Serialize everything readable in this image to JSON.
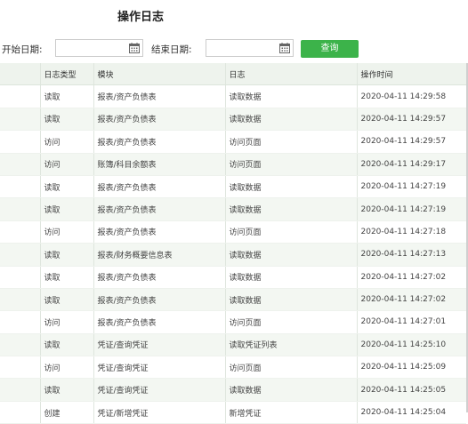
{
  "page": {
    "title": "操作日志"
  },
  "filters": {
    "start_label": "开始日期:",
    "end_label": "结束日期:",
    "start_value": "",
    "end_value": "",
    "query_label": "查询",
    "calendar_icon": "calendar-icon"
  },
  "table": {
    "headers": [
      "日志类型",
      "模块",
      "日志",
      "操作时间"
    ],
    "rows": [
      [
        "读取",
        "报表/资产负债表",
        "读取数据",
        "2020-04-11 14:29:58"
      ],
      [
        "读取",
        "报表/资产负债表",
        "读取数据",
        "2020-04-11 14:29:57"
      ],
      [
        "访问",
        "报表/资产负债表",
        "访问页面",
        "2020-04-11 14:29:57"
      ],
      [
        "访问",
        "账簿/科目余额表",
        "访问页面",
        "2020-04-11 14:29:17"
      ],
      [
        "读取",
        "报表/资产负债表",
        "读取数据",
        "2020-04-11 14:27:19"
      ],
      [
        "读取",
        "报表/资产负债表",
        "读取数据",
        "2020-04-11 14:27:19"
      ],
      [
        "访问",
        "报表/资产负债表",
        "访问页面",
        "2020-04-11 14:27:18"
      ],
      [
        "读取",
        "报表/财务概要信息表",
        "读取数据",
        "2020-04-11 14:27:13"
      ],
      [
        "读取",
        "报表/资产负债表",
        "读取数据",
        "2020-04-11 14:27:02"
      ],
      [
        "读取",
        "报表/资产负债表",
        "读取数据",
        "2020-04-11 14:27:02"
      ],
      [
        "访问",
        "报表/资产负债表",
        "访问页面",
        "2020-04-11 14:27:01"
      ],
      [
        "读取",
        "凭证/查询凭证",
        "读取凭证列表",
        "2020-04-11 14:25:10"
      ],
      [
        "访问",
        "凭证/查询凭证",
        "访问页面",
        "2020-04-11 14:25:09"
      ],
      [
        "读取",
        "凭证/查询凭证",
        "读取数据",
        "2020-04-11 14:25:05"
      ],
      [
        "创建",
        "凭证/新增凭证",
        "新增凭证",
        "2020-04-11 14:25:04"
      ]
    ]
  }
}
